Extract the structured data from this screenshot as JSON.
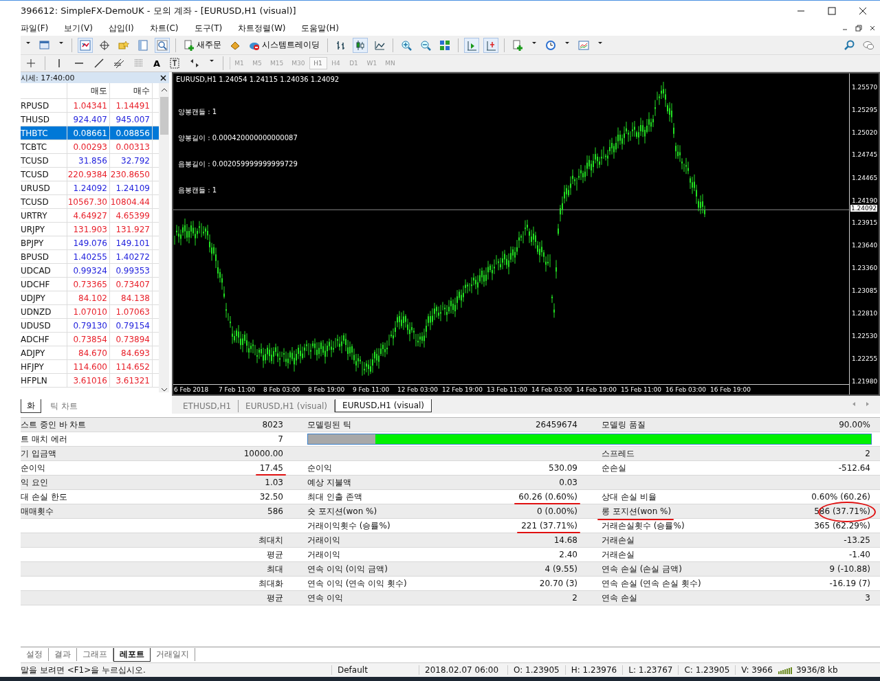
{
  "window": {
    "title": "396612: SimpleFX-DemoUK - 모의 계좌 - [EURUSD,H1 (visual)]"
  },
  "menu": [
    "파일(F)",
    "보기(V)",
    "삽입(I)",
    "차트(C)",
    "도구(T)",
    "차트정렬(W)",
    "도움말(H)"
  ],
  "toolbar": {
    "buttons": [
      "새주문",
      "시스템트레이딩"
    ],
    "text_tool": "A",
    "timeframes": [
      {
        "label": "M1",
        "selected": false
      },
      {
        "label": "M5",
        "selected": false
      },
      {
        "label": "M15",
        "selected": false
      },
      {
        "label": "M30",
        "selected": false
      },
      {
        "label": "H1",
        "selected": true
      },
      {
        "label": "H4",
        "selected": false
      },
      {
        "label": "D1",
        "selected": false
      },
      {
        "label": "W1",
        "selected": false
      },
      {
        "label": "MN",
        "selected": false
      }
    ]
  },
  "market_watch": {
    "title": "시세: 17:40:00",
    "columns": [
      "매도",
      "매수"
    ],
    "rows": [
      {
        "symbol": "RPUSD",
        "bid": "1.04341",
        "ask": "1.14491",
        "selected": false,
        "color": "#e8202a"
      },
      {
        "symbol": "THUSD",
        "bid": "924.407",
        "ask": "945.007",
        "selected": false,
        "color": "#2222dd"
      },
      {
        "symbol": "THBTC",
        "bid": "0.08661",
        "ask": "0.08856",
        "selected": true
      },
      {
        "symbol": "TCBTC",
        "bid": "0.00293",
        "ask": "0.00313",
        "selected": false,
        "color": "#e8202a"
      },
      {
        "symbol": "TCUSD",
        "bid": "31.856",
        "ask": "32.792",
        "selected": false,
        "color": "#2222dd"
      },
      {
        "symbol": "TCUSD",
        "bid": "220.9384",
        "ask": "230.8650",
        "selected": false,
        "color": "#e8202a"
      },
      {
        "symbol": "URUSD",
        "bid": "1.24092",
        "ask": "1.24109",
        "selected": false,
        "color": "#2222dd"
      },
      {
        "symbol": "TCUSD",
        "bid": "10567.30",
        "ask": "10804.44",
        "selected": false,
        "color": "#e8202a"
      },
      {
        "symbol": "URTRY",
        "bid": "4.64927",
        "ask": "4.65399",
        "selected": false,
        "color": "#e8202a"
      },
      {
        "symbol": "URJPY",
        "bid": "131.903",
        "ask": "131.927",
        "selected": false,
        "color": "#e8202a"
      },
      {
        "symbol": "BPJPY",
        "bid": "149.076",
        "ask": "149.101",
        "selected": false,
        "color": "#2222dd"
      },
      {
        "symbol": "BPUSD",
        "bid": "1.40255",
        "ask": "1.40272",
        "selected": false,
        "color": "#2222dd"
      },
      {
        "symbol": "UDCAD",
        "bid": "0.99324",
        "ask": "0.99353",
        "selected": false,
        "color": "#2222dd"
      },
      {
        "symbol": "UDCHF",
        "bid": "0.73365",
        "ask": "0.73407",
        "selected": false,
        "color": "#e8202a"
      },
      {
        "symbol": "UDJPY",
        "bid": "84.102",
        "ask": "84.138",
        "selected": false,
        "color": "#e8202a"
      },
      {
        "symbol": "UDNZD",
        "bid": "1.07010",
        "ask": "1.07063",
        "selected": false,
        "color": "#e8202a"
      },
      {
        "symbol": "UDUSD",
        "bid": "0.79130",
        "ask": "0.79154",
        "selected": false,
        "color": "#2222dd"
      },
      {
        "symbol": "ADCHF",
        "bid": "0.73854",
        "ask": "0.73894",
        "selected": false,
        "color": "#e8202a"
      },
      {
        "symbol": "ADJPY",
        "bid": "84.670",
        "ask": "84.693",
        "selected": false,
        "color": "#e8202a"
      },
      {
        "symbol": "HFJPY",
        "bid": "114.600",
        "ask": "114.652",
        "selected": false,
        "color": "#e8202a"
      },
      {
        "symbol": "HFPLN",
        "bid": "3.61016",
        "ask": "3.61321",
        "selected": false,
        "color": "#e8202a"
      }
    ],
    "tabs": [
      {
        "label": "화",
        "selected": true
      },
      {
        "label": "틱 차트",
        "selected": false
      }
    ]
  },
  "chart": {
    "header": "EURUSD,H1  1.24054 1.24115 1.24036 1.24092",
    "indicators": [
      "양봉캔들 : 1",
      "양봉길이 : 0.000420000000000087",
      "음봉길이 : 0.002059999999999729",
      "음봉캔들 : 1"
    ],
    "price_labels": [
      {
        "label": "1.25570",
        "kind": "tick"
      },
      {
        "label": "1.25295",
        "kind": "tick"
      },
      {
        "label": "1.25020",
        "kind": "tick"
      },
      {
        "label": "1.24745",
        "kind": "tick"
      },
      {
        "label": "1.24465",
        "kind": "tick"
      },
      {
        "label": "1.24190",
        "kind": "tick"
      },
      {
        "label": "1.24092",
        "kind": "current"
      },
      {
        "label": "1.23915",
        "kind": "tick"
      },
      {
        "label": "1.23640",
        "kind": "tick"
      },
      {
        "label": "1.23360",
        "kind": "tick"
      },
      {
        "label": "1.23085",
        "kind": "tick"
      },
      {
        "label": "1.22810",
        "kind": "tick"
      },
      {
        "label": "1.22530",
        "kind": "tick"
      },
      {
        "label": "1.22255",
        "kind": "tick"
      },
      {
        "label": "1.21980",
        "kind": "tick"
      }
    ],
    "time_labels": [
      "6 Feb 2018",
      "7 Feb 11:00",
      "8 Feb 03:00",
      "8 Feb 19:00",
      "9 Feb 11:00",
      "12 Feb 03:00",
      "12 Feb 19:00",
      "13 Feb 11:00",
      "14 Feb 03:00",
      "14 Feb 19:00",
      "15 Feb 11:00",
      "16 Feb 03:00",
      "16 Feb 19:00"
    ],
    "tabs": [
      {
        "label": "ETHUSD,H1",
        "selected": false
      },
      {
        "label": "EURUSD,H1 (visual)",
        "selected": false
      },
      {
        "label": "EURUSD,H1 (visual)",
        "selected": true
      }
    ]
  },
  "report": {
    "rows": [
      {
        "label_1": "스트 중인 바 차트",
        "value_1": "8023",
        "label_2": "모델링된 틱",
        "value_2": "26459674",
        "label_3": "모델링 품질",
        "value_3": "90.00%"
      },
      {
        "label_1": "트 매치 에러",
        "value_1": "7",
        "kind": "quality_bar",
        "level": 0.88
      },
      {
        "label_1": "기 입금액",
        "value_1": "10000.00",
        "label_3": "스프레드",
        "value_3": "2"
      },
      {
        "label_1": "순이익",
        "value_1": "17.45",
        "label_2": "순이익",
        "value_2": "530.09",
        "label_3": "순손실",
        "value_3": "-512.64",
        "value_1_underlined": true
      },
      {
        "label_1": "익 요인",
        "value_1": "1.03",
        "label_2": "예상 지불액",
        "value_2": "0.03"
      },
      {
        "label_1": "대 손실 한도",
        "value_1": "32.50",
        "label_2": "최대 인출 존액",
        "value_2": "60.26 (0.60%)",
        "label_3": "상대 손실 비율",
        "value_3": "0.60% (60.26)",
        "value_2_underlined": true
      },
      {
        "label_1": "매매횟수",
        "value_1": "586",
        "label_2": "숏 포지션(won %)",
        "value_2": "0 (0.00%)",
        "label_3": "롱 포지션(won %)",
        "value_3": "586 (37.71%)",
        "label_3_underlined": true,
        "value_3_circled": true
      },
      {
        "label_2": "거래이익횟수 (승률%)",
        "value_2": "221 (37.71%)",
        "label_3": "거래손실횟수 (승률%)",
        "value_3": "365 (62.29%)",
        "value_2_underlined": true
      },
      {
        "value_1": "최대치",
        "label_2": "거래이익",
        "value_2": "14.68",
        "label_3": "거래손실",
        "value_3": "-13.25"
      },
      {
        "value_1": "평균",
        "label_2": "거래이익",
        "value_2": "2.40",
        "label_3": "거래손실",
        "value_3": "-1.40"
      },
      {
        "value_1": "최대",
        "label_2": "연속 이익 (이익 금액)",
        "value_2": "4 (9.55)",
        "label_3": "연속 손실 (손실 금액)",
        "value_3": "9 (-10.88)"
      },
      {
        "value_1": "최대화",
        "label_2": "연속 이익 (연속 이익 횟수)",
        "value_2": "20.70 (3)",
        "label_3": "연속 손실 (연속 손실 횟수)",
        "value_3": "-16.19 (7)"
      },
      {
        "value_1": "평균",
        "label_2": "연속 이익",
        "value_2": "2",
        "label_3": "연속 손실",
        "value_3": "3"
      }
    ]
  },
  "bottom_tabs": [
    {
      "label": "설정",
      "selected": false
    },
    {
      "label": "결과",
      "selected": false
    },
    {
      "label": "그래프",
      "selected": false
    },
    {
      "label": "레포트",
      "selected": true
    },
    {
      "label": "거래일지",
      "selected": false
    }
  ],
  "status_bar": {
    "message": "말을 보려면 <F1>을 누르십시오.",
    "profile": "Default",
    "time": "2018.02.07 06:00",
    "open": "O: 1.23905",
    "high": "H: 1.23976",
    "low": "L: 1.23767",
    "close": "C: 1.23905",
    "volume": "V: 3966",
    "traffic": "3936/8 kb"
  }
}
